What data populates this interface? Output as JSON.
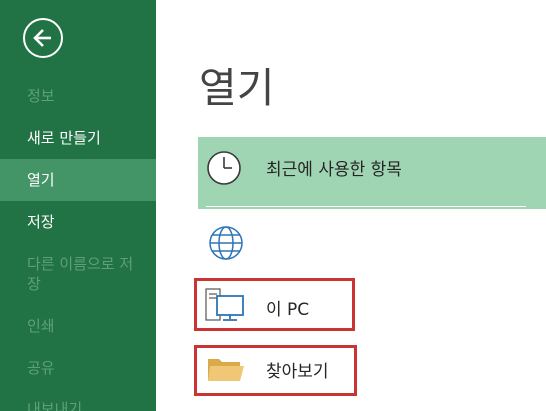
{
  "sidebar": {
    "items": [
      {
        "label": "정보",
        "state": "disabled"
      },
      {
        "label": "새로 만들기",
        "state": "normal"
      },
      {
        "label": "열기",
        "state": "selected"
      },
      {
        "label": "저장",
        "state": "normal"
      },
      {
        "label": "다른 이름으로 저장",
        "state": "disabled"
      },
      {
        "label": "인쇄",
        "state": "disabled"
      },
      {
        "label": "공유",
        "state": "disabled"
      },
      {
        "label": "내보내기",
        "state": "disabled"
      }
    ]
  },
  "main": {
    "title": "열기",
    "locations": [
      {
        "label": "최근에 사용한 항목",
        "icon": "clock-icon",
        "selected": true
      },
      {
        "label": "",
        "icon": "globe-icon"
      },
      {
        "label": "이 PC",
        "icon": "pc-icon",
        "highlighted": true
      },
      {
        "label": "찾아보기",
        "icon": "folder-icon",
        "highlighted": true
      }
    ]
  },
  "colors": {
    "sidebar_bg": "#217346",
    "sidebar_selected": "#439467",
    "sidebar_disabled_text": "#5f9f7a",
    "recent_band": "#a0d5b4",
    "highlight_border": "#cc3333"
  }
}
